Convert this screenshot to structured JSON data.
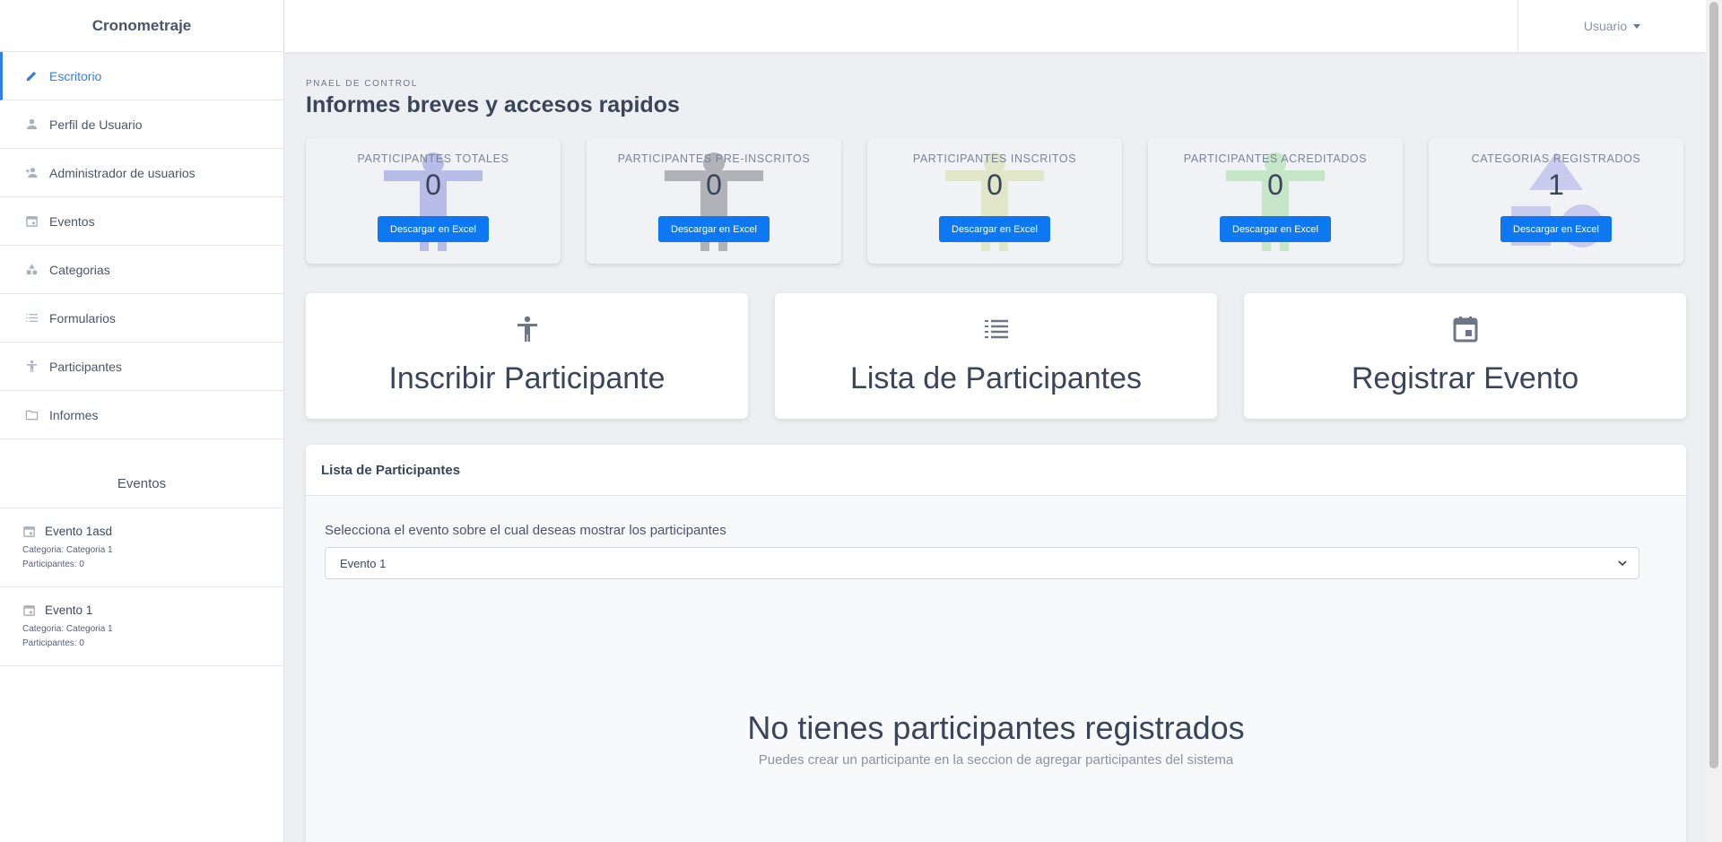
{
  "sidebar": {
    "brand": "Cronometraje",
    "items": [
      {
        "label": "Escritorio",
        "icon": "pencil-icon"
      },
      {
        "label": "Perfil de Usuario",
        "icon": "user-icon"
      },
      {
        "label": "Administrador de usuarios",
        "icon": "user-add-icon"
      },
      {
        "label": "Eventos",
        "icon": "calendar-icon"
      },
      {
        "label": "Categorias",
        "icon": "shapes-icon"
      },
      {
        "label": "Formularios",
        "icon": "list-icon"
      },
      {
        "label": "Participantes",
        "icon": "person-icon"
      },
      {
        "label": "Informes",
        "icon": "folder-icon"
      }
    ],
    "events_title": "Eventos",
    "events": [
      {
        "name": "Evento 1asd",
        "category": "Categoria: Categoria 1",
        "participants": "Participantes: 0"
      },
      {
        "name": "Evento 1",
        "category": "Categoria: Categoria 1",
        "participants": "Participantes: 0"
      }
    ]
  },
  "topbar": {
    "user_label": "Usuario"
  },
  "main": {
    "eyebrow": "PNAEL DE CONTROL",
    "title": "Informes breves y accesos rapidos",
    "stats": [
      {
        "label": "PARTICIPANTES TOTALES",
        "value": "0",
        "button": "Descargar en Excel",
        "color": "#b8bde8"
      },
      {
        "label": "PARTICIPANTES PRE-INSCRITOS",
        "value": "0",
        "button": "Descargar en Excel",
        "color": "#b0b2b8"
      },
      {
        "label": "PARTICIPANTES INSCRITOS",
        "value": "0",
        "button": "Descargar en Excel",
        "color": "#e2e6c8"
      },
      {
        "label": "PARTICIPANTES ACREDITADOS",
        "value": "0",
        "button": "Descargar en Excel",
        "color": "#c6e6c8"
      },
      {
        "label": "CATEGORIAS REGISTRADOS",
        "value": "1",
        "button": "Descargar en Excel",
        "color": "#c8cbee"
      }
    ],
    "quick_links": [
      {
        "label": "Inscribir Participante",
        "icon": "person-icon"
      },
      {
        "label": "Lista de Participantes",
        "icon": "list-icon"
      },
      {
        "label": "Registrar Evento",
        "icon": "calendar-icon"
      }
    ],
    "panel": {
      "title": "Lista de Participantes",
      "select_label": "Selecciona el evento sobre el cual deseas mostrar los participantes",
      "select_value": "Evento 1",
      "empty_title": "No tienes participantes registrados",
      "empty_sub": "Puedes crear un participante en la seccion de agregar participantes del sistema"
    }
  },
  "colors": {
    "accent": "#2f7fe6",
    "button": "#0d78f2"
  }
}
